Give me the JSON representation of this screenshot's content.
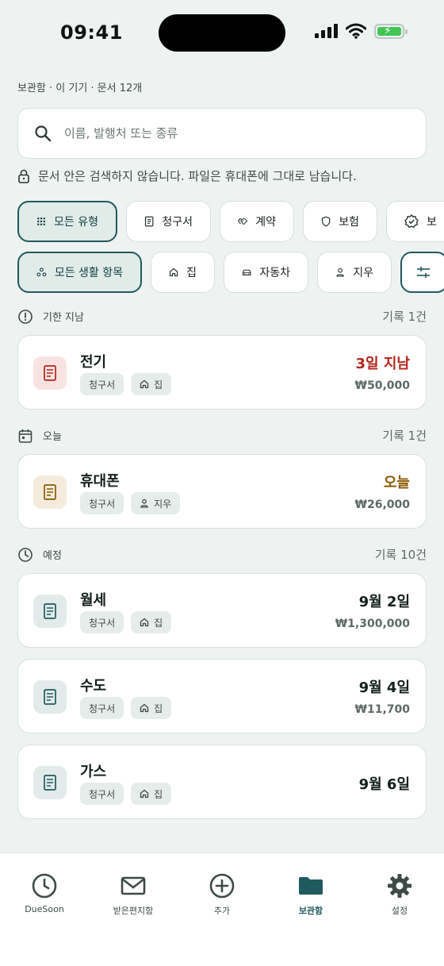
{
  "status_bar": {
    "time": "09:41"
  },
  "breadcrumb": "보관함 · 이 기기 · 문서 12개",
  "search": {
    "placeholder": "이름, 발행처 또는 종류"
  },
  "privacy_note": "문서 안은 검색하지 않습니다. 파일은 휴대폰에 그대로 남습니다.",
  "type_filters": [
    {
      "label": "모든 유형",
      "icon": "grid-icon",
      "active": true
    },
    {
      "label": "청구서",
      "icon": "receipt-icon",
      "active": false
    },
    {
      "label": "계약",
      "icon": "handshake-icon",
      "active": false
    },
    {
      "label": "보험",
      "icon": "shield-icon",
      "active": false
    },
    {
      "label": "보",
      "icon": "badge-check-icon",
      "active": false
    }
  ],
  "life_filters": [
    {
      "label": "모든 생활 항목",
      "icon": "circles-icon",
      "active": true
    },
    {
      "label": "집",
      "icon": "home-icon",
      "active": false
    },
    {
      "label": "자동차",
      "icon": "car-icon",
      "active": false
    },
    {
      "label": "지우",
      "icon": "person-icon",
      "active": false
    },
    {
      "label": "",
      "icon": "sliders-icon",
      "active": false
    }
  ],
  "sections": {
    "overdue": {
      "title": "기한 지남",
      "count": "기록 1건",
      "icon": "alert-circle-icon"
    },
    "today": {
      "title": "오늘",
      "count": "기록 1건",
      "icon": "calendar-icon"
    },
    "upcoming": {
      "title": "예정",
      "count": "기록 10건",
      "icon": "clock-icon"
    }
  },
  "records": [
    {
      "name": "전기",
      "type_tag": "청구서",
      "life_tag": "집",
      "life_icon": "home-icon",
      "due": "3일 지남",
      "amount": "₩50,000",
      "due_color": "#b3261e",
      "icon_bg": "#f8e3e2",
      "icon_color": "#b3261e"
    },
    {
      "name": "휴대폰",
      "type_tag": "청구서",
      "life_tag": "지우",
      "life_icon": "person-icon",
      "due": "오늘",
      "amount": "₩26,000",
      "due_color": "#8a5a00",
      "icon_bg": "#f5ebdd",
      "icon_color": "#8a5a00"
    },
    {
      "name": "월세",
      "type_tag": "청구서",
      "life_tag": "집",
      "life_icon": "home-icon",
      "due": "9월 2일",
      "amount": "₩1,300,000",
      "due_color": "#14201d",
      "icon_bg": "#e2ebea",
      "icon_color": "#1f5a5e"
    },
    {
      "name": "수도",
      "type_tag": "청구서",
      "life_tag": "집",
      "life_icon": "home-icon",
      "due": "9월 4일",
      "amount": "₩11,700",
      "due_color": "#14201d",
      "icon_bg": "#e2ebea",
      "icon_color": "#1f5a5e"
    },
    {
      "name": "가스",
      "type_tag": "청구서",
      "life_tag": "집",
      "life_icon": "home-icon",
      "due": "9월 6일",
      "amount": "",
      "due_color": "#14201d",
      "icon_bg": "#e2ebea",
      "icon_color": "#1f5a5e"
    }
  ],
  "bottom_nav": [
    {
      "label": "DueSoon",
      "icon": "clock-icon",
      "active": false
    },
    {
      "label": "받은편지함",
      "icon": "mail-icon",
      "active": false
    },
    {
      "label": "추가",
      "icon": "plus-circle-icon",
      "active": false
    },
    {
      "label": "보관함",
      "icon": "folder-icon",
      "active": true
    },
    {
      "label": "설정",
      "icon": "gear-icon",
      "active": false
    }
  ],
  "colors": {
    "accent": "#1f5a5e",
    "background": "#eef3f1",
    "overdue": "#b3261e",
    "today": "#8a5a00"
  }
}
